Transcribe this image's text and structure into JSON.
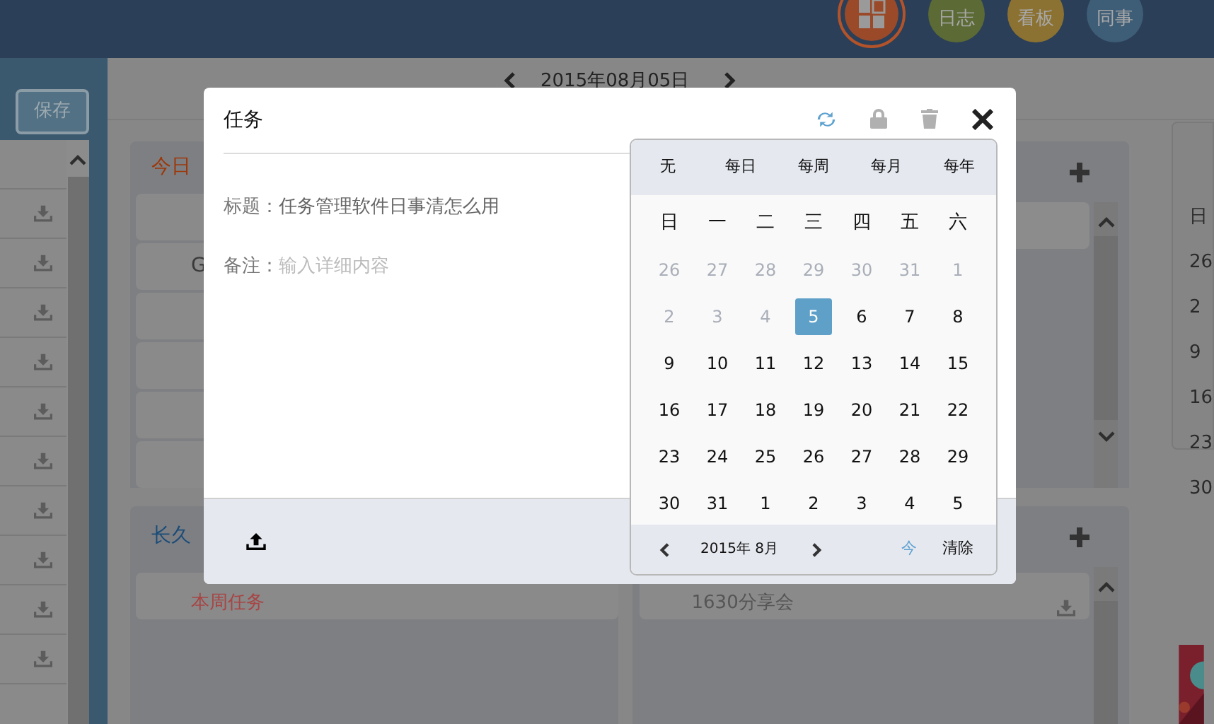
{
  "header": {
    "nav_buttons": [
      {
        "label": "日志",
        "color": "#5c6a35"
      },
      {
        "label": "看板",
        "color": "#8c7232"
      },
      {
        "label": "同事",
        "color": "#3e5d76"
      }
    ]
  },
  "date_nav": {
    "date": "2015年08月05日"
  },
  "sidebar": {
    "save_button": "保存"
  },
  "panels": [
    {
      "title": "今日",
      "color": "#9c3808",
      "items": [
        {
          "text": "G",
          "color": "#3a3a3a"
        }
      ]
    },
    {
      "title": "长久",
      "color": "#1a4c78",
      "items": [
        {
          "text": "本周任务",
          "color": "#a84444"
        }
      ]
    }
  ],
  "side_panel": {
    "items": [
      {
        "text": "1630分享会"
      }
    ]
  },
  "mini_calendar": {
    "weekday": "日",
    "days": [
      "26",
      "2",
      "9",
      "16",
      "23",
      "30"
    ]
  },
  "dialog": {
    "title": "任务",
    "fields": [
      {
        "label": "标题：",
        "value": "任务管理软件日事清怎么用"
      },
      {
        "label": "备注：",
        "placeholder": "输入详细内容"
      }
    ],
    "date_picker": {
      "repeat_options": [
        "无",
        "每日",
        "每周",
        "每月",
        "每年"
      ],
      "weekdays": [
        "日",
        "一",
        "二",
        "三",
        "四",
        "五",
        "六"
      ],
      "weeks": [
        [
          {
            "day": "26",
            "muted": true,
            "selected": false
          },
          {
            "day": "27",
            "muted": true,
            "selected": false
          },
          {
            "day": "28",
            "muted": true,
            "selected": false
          },
          {
            "day": "29",
            "muted": true,
            "selected": false
          },
          {
            "day": "30",
            "muted": true,
            "selected": false
          },
          {
            "day": "31",
            "muted": true,
            "selected": false
          },
          {
            "day": "1",
            "muted": true,
            "selected": false
          }
        ],
        [
          {
            "day": "2",
            "muted": true,
            "selected": false
          },
          {
            "day": "3",
            "muted": true,
            "selected": false
          },
          {
            "day": "4",
            "muted": true,
            "selected": false
          },
          {
            "day": "5",
            "muted": false,
            "selected": true
          },
          {
            "day": "6",
            "muted": false,
            "selected": false
          },
          {
            "day": "7",
            "muted": false,
            "selected": false
          },
          {
            "day": "8",
            "muted": false,
            "selected": false
          }
        ],
        [
          {
            "day": "9",
            "muted": false,
            "selected": false
          },
          {
            "day": "10",
            "muted": false,
            "selected": false
          },
          {
            "day": "11",
            "muted": false,
            "selected": false
          },
          {
            "day": "12",
            "muted": false,
            "selected": false
          },
          {
            "day": "13",
            "muted": false,
            "selected": false
          },
          {
            "day": "14",
            "muted": false,
            "selected": false
          },
          {
            "day": "15",
            "muted": false,
            "selected": false
          }
        ],
        [
          {
            "day": "16",
            "muted": false,
            "selected": false
          },
          {
            "day": "17",
            "muted": false,
            "selected": false
          },
          {
            "day": "18",
            "muted": false,
            "selected": false
          },
          {
            "day": "19",
            "muted": false,
            "selected": false
          },
          {
            "day": "20",
            "muted": false,
            "selected": false
          },
          {
            "day": "21",
            "muted": false,
            "selected": false
          },
          {
            "day": "22",
            "muted": false,
            "selected": false
          }
        ],
        [
          {
            "day": "23",
            "muted": false,
            "selected": false
          },
          {
            "day": "24",
            "muted": false,
            "selected": false
          },
          {
            "day": "25",
            "muted": false,
            "selected": false
          },
          {
            "day": "26",
            "muted": false,
            "selected": false
          },
          {
            "day": "27",
            "muted": false,
            "selected": false
          },
          {
            "day": "28",
            "muted": false,
            "selected": false
          },
          {
            "day": "29",
            "muted": false,
            "selected": false
          }
        ],
        [
          {
            "day": "30",
            "muted": false,
            "selected": false
          },
          {
            "day": "31",
            "muted": false,
            "selected": false
          },
          {
            "day": "1",
            "muted": false,
            "selected": false
          },
          {
            "day": "2",
            "muted": false,
            "selected": false
          },
          {
            "day": "3",
            "muted": false,
            "selected": false
          },
          {
            "day": "4",
            "muted": false,
            "selected": false
          },
          {
            "day": "5",
            "muted": false,
            "selected": false
          }
        ]
      ],
      "month_label": "2015年 8月",
      "today_button": "今",
      "clear_button": "清除"
    }
  }
}
